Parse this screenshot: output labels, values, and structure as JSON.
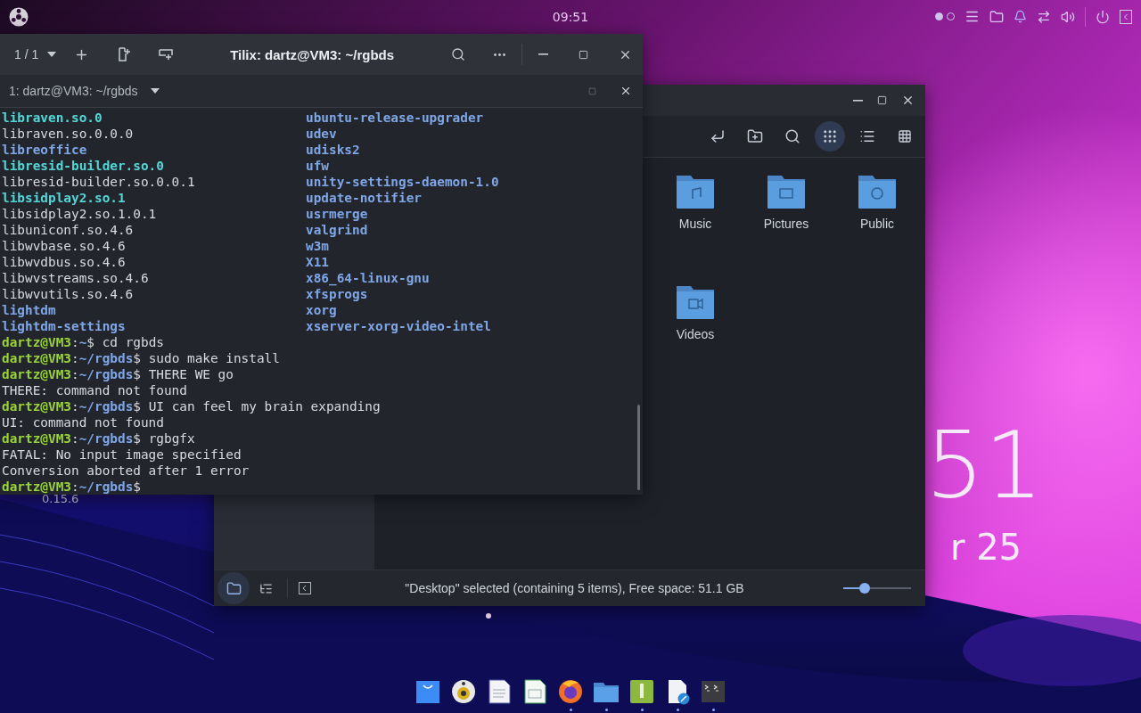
{
  "top_bar": {
    "clock": "09:51",
    "workspaces": [
      {
        "selected": true
      },
      {
        "selected": false
      }
    ]
  },
  "desktop": {
    "clock_fragment": "51",
    "date_fragment": "r 25",
    "version_label": "0.15.6"
  },
  "terminal": {
    "session_counter": "1 / 1",
    "title": "Tilix: dartz@VM3: ~/rgbds",
    "tab_title": "1: dartz@VM3: ~/rgbds",
    "listing": [
      {
        "left": {
          "text": "libraven.so.0",
          "kind": "link"
        },
        "right": {
          "text": "ubuntu-release-upgrader",
          "kind": "dir"
        }
      },
      {
        "left": {
          "text": "libraven.so.0.0.0",
          "kind": "file"
        },
        "right": {
          "text": "udev",
          "kind": "dir"
        }
      },
      {
        "left": {
          "text": "libreoffice",
          "kind": "dir"
        },
        "right": {
          "text": "udisks2",
          "kind": "dir"
        }
      },
      {
        "left": {
          "text": "libresid-builder.so.0",
          "kind": "link"
        },
        "right": {
          "text": "ufw",
          "kind": "dir"
        }
      },
      {
        "left": {
          "text": "libresid-builder.so.0.0.1",
          "kind": "file"
        },
        "right": {
          "text": "unity-settings-daemon-1.0",
          "kind": "dir"
        }
      },
      {
        "left": {
          "text": "libsidplay2.so.1",
          "kind": "link"
        },
        "right": {
          "text": "update-notifier",
          "kind": "dir"
        }
      },
      {
        "left": {
          "text": "libsidplay2.so.1.0.1",
          "kind": "file"
        },
        "right": {
          "text": "usrmerge",
          "kind": "dir"
        }
      },
      {
        "left": {
          "text": "libuniconf.so.4.6",
          "kind": "file"
        },
        "right": {
          "text": "valgrind",
          "kind": "dir"
        }
      },
      {
        "left": {
          "text": "libwvbase.so.4.6",
          "kind": "file"
        },
        "right": {
          "text": "w3m",
          "kind": "dir"
        }
      },
      {
        "left": {
          "text": "libwvdbus.so.4.6",
          "kind": "file"
        },
        "right": {
          "text": "X11",
          "kind": "dir"
        }
      },
      {
        "left": {
          "text": "libwvstreams.so.4.6",
          "kind": "file"
        },
        "right": {
          "text": "x86_64-linux-gnu",
          "kind": "dir"
        }
      },
      {
        "left": {
          "text": "libwvutils.so.4.6",
          "kind": "file"
        },
        "right": {
          "text": "xfsprogs",
          "kind": "dir"
        }
      },
      {
        "left": {
          "text": "lightdm",
          "kind": "dir"
        },
        "right": {
          "text": "xorg",
          "kind": "dir"
        }
      },
      {
        "left": {
          "text": "lightdm-settings",
          "kind": "dir"
        },
        "right": {
          "text": "xserver-xorg-video-intel",
          "kind": "dir"
        }
      }
    ],
    "session": [
      {
        "kind": "prompt",
        "user": "dartz@VM3",
        "sep": ":",
        "path": "~",
        "sign": "$",
        "command": "cd rgbds"
      },
      {
        "kind": "prompt",
        "user": "dartz@VM3",
        "sep": ":",
        "path": "~/rgbds",
        "sign": "$",
        "command": "sudo make install"
      },
      {
        "kind": "prompt",
        "user": "dartz@VM3",
        "sep": ":",
        "path": "~/rgbds",
        "sign": "$",
        "command": "THERE WE go"
      },
      {
        "kind": "output",
        "text": "THERE: command not found"
      },
      {
        "kind": "prompt",
        "user": "dartz@VM3",
        "sep": ":",
        "path": "~/rgbds",
        "sign": "$",
        "command": "UI can feel my brain expanding"
      },
      {
        "kind": "output",
        "text": "UI: command not found"
      },
      {
        "kind": "prompt",
        "user": "dartz@VM3",
        "sep": ":",
        "path": "~/rgbds",
        "sign": "$",
        "command": "rgbgfx"
      },
      {
        "kind": "output",
        "text": "FATAL: No input image specified"
      },
      {
        "kind": "output",
        "text": "Conversion aborted after 1 error"
      },
      {
        "kind": "prompt",
        "user": "dartz@VM3",
        "sep": ":",
        "path": "~/rgbds",
        "sign": "$"
      }
    ]
  },
  "file_manager": {
    "toolbar": [
      {
        "kind": "back",
        "selected": false
      },
      {
        "kind": "new-folder",
        "selected": false
      },
      {
        "kind": "search",
        "selected": false
      },
      {
        "kind": "icons",
        "selected": true
      },
      {
        "kind": "details",
        "selected": false
      },
      {
        "kind": "compact",
        "selected": false
      }
    ],
    "folders": [
      {
        "name": "Music",
        "kind": "music"
      },
      {
        "name": "Pictures",
        "kind": "pictures"
      },
      {
        "name": "Public",
        "kind": "public"
      },
      {
        "name": "Videos",
        "kind": "videos"
      }
    ],
    "sidebar_toggles": [
      {
        "kind": "places",
        "selected": true
      },
      {
        "kind": "tree",
        "selected": false
      }
    ],
    "status": "\"Desktop\" selected (containing 5 items), Free space: 51.1 GB",
    "zoom": {
      "level": 0.31
    }
  },
  "dock": [
    {
      "kind": "store",
      "running": false
    },
    {
      "kind": "music",
      "running": false
    },
    {
      "kind": "writer",
      "running": false
    },
    {
      "kind": "calc",
      "running": false
    },
    {
      "kind": "browser",
      "running": true
    },
    {
      "kind": "files",
      "running": true
    },
    {
      "kind": "archive",
      "running": true
    },
    {
      "kind": "editor",
      "running": true
    },
    {
      "kind": "terminal",
      "running": true
    }
  ]
}
